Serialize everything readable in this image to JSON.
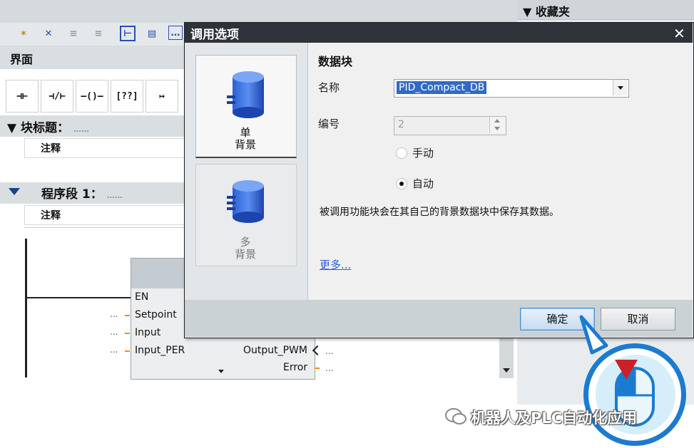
{
  "favorites": {
    "title": "▼ 收藏夹"
  },
  "toolbar": {
    "icons": [
      "insert-network-icon",
      "delete-network-icon",
      "insert-row-icon",
      "delete-row-icon",
      "open-branch-icon",
      "close-branch-icon",
      "comment-icon"
    ]
  },
  "interface_label": "界面",
  "ladder": {
    "items": [
      "⊣⊢",
      "⊣/⊢",
      "—()—",
      "[??]",
      "↦"
    ]
  },
  "block": {
    "title": "▼ 块标题：",
    "dots": "……",
    "comment": "注释"
  },
  "segment": {
    "title": "程序段 1：",
    "dots": "……",
    "comment": "注释"
  },
  "function_block": {
    "inputs": [
      {
        "name": "EN",
        "value": ""
      },
      {
        "name": "Setpoint",
        "value": "..."
      },
      {
        "name": "Input",
        "value": "..."
      },
      {
        "name": "Input_PER",
        "value": "..."
      }
    ],
    "outputs": [
      {
        "name": "Output_PWM",
        "value": "..."
      },
      {
        "name": "Error",
        "value": "..."
      }
    ]
  },
  "dialog": {
    "title": "调用选项",
    "close": "✕",
    "options": [
      {
        "label_line1": "单",
        "label_line2": "背景",
        "selected": true
      },
      {
        "label_line1": "多",
        "label_line2": "背景",
        "selected": false
      }
    ],
    "section_title": "数据块",
    "name_label": "名称",
    "name_value": "PID_Compact_DB",
    "number_label": "编号",
    "number_value": "2",
    "radio_manual": "手动",
    "radio_auto": "自动",
    "auto_selected": true,
    "description": "被调用功能块会在其自己的背景数据块中保存其数据。",
    "more_link": "更多...",
    "ok_button": "确定",
    "cancel_button": "取消"
  },
  "watermark": "机器人及PLC自动化应用",
  "colors": {
    "title_bar": "#2d3338",
    "accent_blue": "#1b7bd0",
    "db_icon": "#1d62d6",
    "cursor_red": "#cc1f28"
  }
}
